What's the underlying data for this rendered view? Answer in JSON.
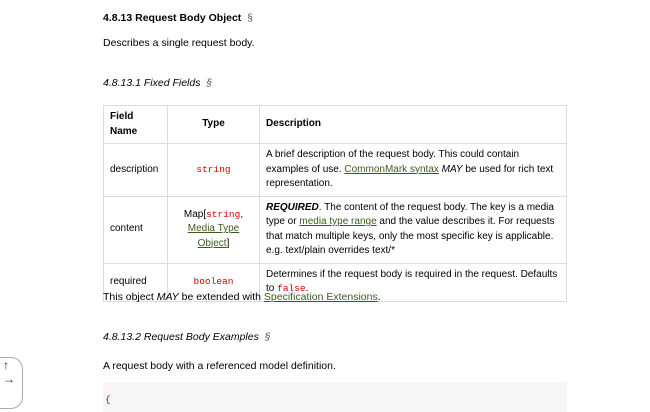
{
  "heading": {
    "title": "4.8.13 Request Body Object",
    "section_mark": "§"
  },
  "intro": "Describes a single request body.",
  "fixed_fields": {
    "title": "4.8.13.1 Fixed Fields",
    "section_mark": "§"
  },
  "table": {
    "headers": {
      "field": "Field Name",
      "type": "Type",
      "description": "Description"
    },
    "rows": [
      {
        "field": "description",
        "type": "string",
        "desc_part1": "A brief description of the request body. This could contain examples of use. ",
        "desc_link": "CommonMark syntax",
        "desc_may": "MAY",
        "desc_part2": " be used for rich text representation."
      },
      {
        "field": "content",
        "type_prefix": "Map[",
        "type_code": "string",
        "type_sep": ", ",
        "type_link": "Media Type Object",
        "type_suffix": "]",
        "desc_required": "REQUIRED",
        "desc_part1": ". The content of the request body. The key is a media type or ",
        "desc_link": "media type range",
        "desc_part2": " and the value describes it. For requests that match multiple keys, only the most specific key is applicable. e.g. text/plain overrides text/*"
      },
      {
        "field": "required",
        "type": "boolean",
        "desc_part1": "Determines if the request body is required in the request. Defaults to ",
        "desc_code": "false",
        "desc_part2": "."
      }
    ]
  },
  "extension": {
    "prefix": "This object ",
    "may": "MAY",
    "middle": " be extended with ",
    "link": "Specification Extensions",
    "suffix": "."
  },
  "examples": {
    "title": "4.8.13.2 Request Body Examples",
    "section_mark": "§"
  },
  "example_desc": "A request body with a referenced model definition.",
  "code_start": "{",
  "side_icons": {
    "up": "↑",
    "right": "→"
  }
}
